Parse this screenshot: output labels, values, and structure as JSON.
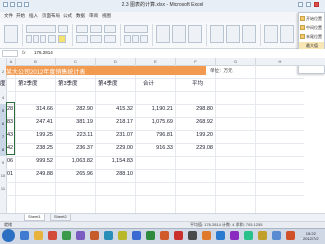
{
  "window": {
    "title": "2.3 图表的计算.xlsx - Microsoft Excel"
  },
  "formula_bar": {
    "name_box": "",
    "fx": "fx",
    "formula": "176.2814"
  },
  "sheet": {
    "banner_title": "某大公司2012年度销售统计表",
    "unit_label": "单位：万元",
    "col_headers": [
      "A",
      "B",
      "C",
      "D",
      "E",
      "F",
      "G",
      "H"
    ],
    "row_numbers": [
      "2",
      "3",
      "4",
      "5",
      "6",
      "7",
      "8",
      "9",
      "10",
      "11"
    ],
    "table_headers": [
      "度",
      "第2季度",
      "第3季度",
      "第4季度",
      "合计",
      "平均"
    ],
    "rows": [
      [
        "28",
        "314.66",
        "282.90",
        "415.32",
        "1,190.21",
        "298.80"
      ],
      [
        "83",
        "247.41",
        "381.19",
        "218.17",
        "1,075.69",
        "268.92"
      ],
      [
        "43",
        "199.25",
        "223.11",
        "231.07",
        "796.81",
        "199.20"
      ],
      [
        "42",
        "238.25",
        "236.37",
        "229.00",
        "916.33",
        "229.08"
      ],
      [
        "06",
        "999.52",
        "1,063.82",
        "1,154.83",
        "",
        ""
      ],
      [
        "01",
        "249.88",
        "265.96",
        "288.10",
        "",
        ""
      ]
    ]
  },
  "ribbon": {
    "tabs": [
      "文件",
      "开始",
      "插入",
      "页面布局",
      "公式",
      "数据",
      "审阅",
      "视图"
    ]
  },
  "side_panel": {
    "items": [
      "开始位置",
      "中间位置",
      "末尾位置",
      "最大值",
      "最小值",
      "..."
    ]
  },
  "sheet_tabs": [
    "Sheet1",
    "Sheet2"
  ],
  "status": {
    "left": "就绪",
    "right": "平均值: 176.2814  计数: 4  求和: 705.1255"
  },
  "taskbar": {
    "time": "15:22",
    "date": "2012/7/2"
  },
  "colors": {
    "banner": "#f19a50",
    "selection": "#2e6b3a"
  }
}
